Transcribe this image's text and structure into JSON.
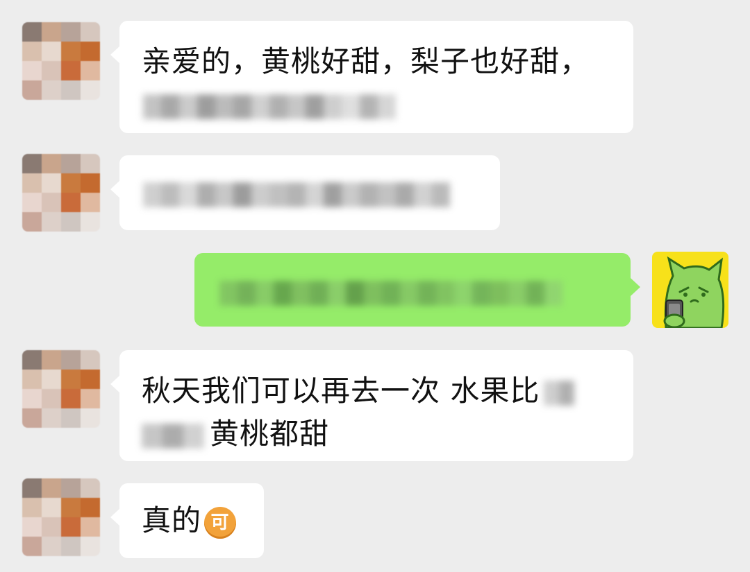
{
  "chat": {
    "messages": [
      {
        "side": "left",
        "lines": [
          "亲爱的，黄桃好甜，梨子也好甜，",
          ""
        ],
        "redacted_line2": true
      },
      {
        "side": "left",
        "lines": [
          ""
        ],
        "redacted": true
      },
      {
        "side": "right",
        "lines": [
          ""
        ],
        "redacted": true
      },
      {
        "side": "left",
        "line1": "秋天我们可以再去一次 水果比",
        "line2": "黄桃都甜"
      },
      {
        "side": "left",
        "text": "真的",
        "emoji": "可"
      }
    ]
  },
  "icons": {
    "contact_avatar": "blurred-contact-avatar",
    "self_avatar": "green-cat-phone-avatar",
    "emoji": "ke-emoji-icon"
  },
  "colors": {
    "background": "#ededed",
    "received_bubble": "#ffffff",
    "sent_bubble": "#95ec69",
    "self_avatar_bg": "#f7e11a",
    "emoji_orange": "#f2a23a"
  }
}
